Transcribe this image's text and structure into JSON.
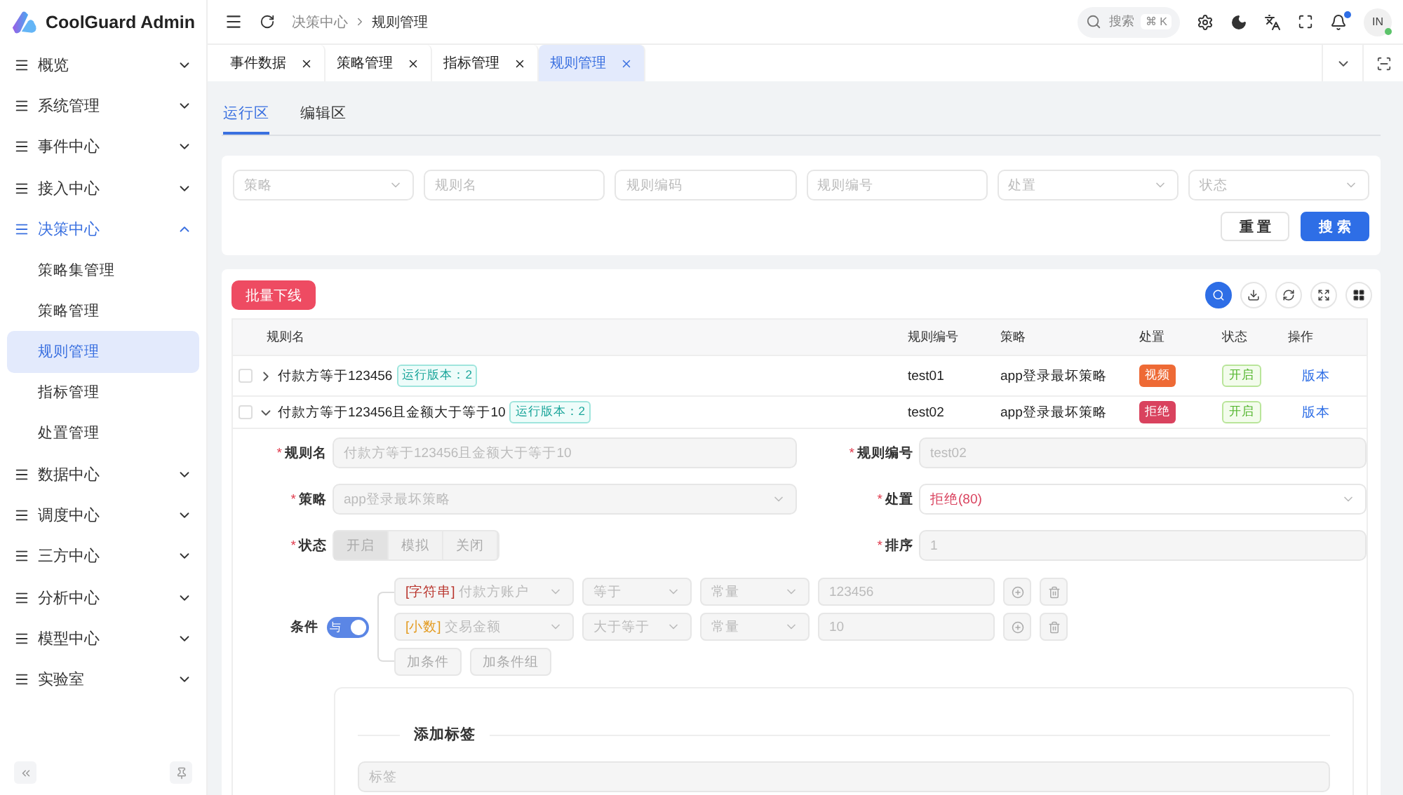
{
  "app": {
    "title": "CoolGuard Admin"
  },
  "sidebar": {
    "items": [
      {
        "label": "概览",
        "expanded": false
      },
      {
        "label": "系统管理",
        "expanded": false
      },
      {
        "label": "事件中心",
        "expanded": false
      },
      {
        "label": "接入中心",
        "expanded": false
      },
      {
        "label": "决策中心",
        "expanded": true,
        "children": [
          {
            "label": "策略集管理",
            "selected": false
          },
          {
            "label": "策略管理",
            "selected": false
          },
          {
            "label": "规则管理",
            "selected": true
          },
          {
            "label": "指标管理",
            "selected": false
          },
          {
            "label": "处置管理",
            "selected": false
          }
        ]
      },
      {
        "label": "数据中心",
        "expanded": false
      },
      {
        "label": "调度中心",
        "expanded": false
      },
      {
        "label": "三方中心",
        "expanded": false
      },
      {
        "label": "分析中心",
        "expanded": false
      },
      {
        "label": "模型中心",
        "expanded": false
      },
      {
        "label": "实验室",
        "expanded": false
      }
    ]
  },
  "header": {
    "breadcrumb": [
      "决策中心",
      "规则管理"
    ],
    "search": {
      "placeholder": "搜索",
      "shortcut": "⌘ K"
    },
    "has_notification": true,
    "avatar": "IN",
    "online": true
  },
  "tabs": [
    {
      "label": "事件数据",
      "selected": false
    },
    {
      "label": "策略管理",
      "selected": false
    },
    {
      "label": "指标管理",
      "selected": false
    },
    {
      "label": "规则管理",
      "selected": true
    }
  ],
  "subtabs": [
    {
      "label": "运行区",
      "selected": true
    },
    {
      "label": "编辑区",
      "selected": false
    }
  ],
  "filters": [
    {
      "kind": "select",
      "placeholder": "策略"
    },
    {
      "kind": "input",
      "placeholder": "规则名"
    },
    {
      "kind": "input",
      "placeholder": "规则编码"
    },
    {
      "kind": "input",
      "placeholder": "规则编号"
    },
    {
      "kind": "select",
      "placeholder": "处置"
    },
    {
      "kind": "select",
      "placeholder": "状态"
    }
  ],
  "filter_buttons": {
    "reset": "重 置",
    "search": "搜 索"
  },
  "batch_button": "批量下线",
  "table": {
    "columns": [
      "规则名",
      "规则编号",
      "策略",
      "处置",
      "状态",
      "操作"
    ],
    "rows": [
      {
        "checked": false,
        "expanded": false,
        "name": "付款方等于123456",
        "version": "运行版本：2",
        "code": "test01",
        "strategy": "app登录最坏策略",
        "action": {
          "label": "视频",
          "color": "#ee6a35"
        },
        "status": "开启",
        "op": "版本"
      },
      {
        "checked": false,
        "expanded": true,
        "name": "付款方等于123456且金额大于等于10",
        "version": "运行版本：2",
        "code": "test02",
        "strategy": "app登录最坏策略",
        "action": {
          "label": "拒绝",
          "color": "#d9425e"
        },
        "status": "开启",
        "op": "版本"
      }
    ]
  },
  "detail": {
    "fields": [
      {
        "kind": "input",
        "required_mark": "*",
        "label": "规则名",
        "disabled": true,
        "value": "付款方等于123456且金额大于等于10"
      },
      {
        "kind": "input",
        "required_mark": "*",
        "label": "规则编号",
        "disabled": true,
        "value": "test02"
      },
      {
        "kind": "select",
        "required_mark": "*",
        "label": "策略",
        "disabled": true,
        "value": "app登录最坏策略",
        "danger": false
      },
      {
        "kind": "select",
        "required_mark": "*",
        "label": "处置",
        "disabled": false,
        "value": "拒绝(80)",
        "danger": true
      },
      {
        "kind": "segmented",
        "required_mark": "*",
        "label": "状态",
        "disabled": true,
        "options": [
          {
            "label": "开启",
            "selected": true
          },
          {
            "label": "模拟",
            "selected": false
          },
          {
            "label": "关闭",
            "selected": false
          }
        ]
      },
      {
        "kind": "input",
        "required_mark": "*",
        "label": "排序",
        "disabled": true,
        "value": "1"
      }
    ],
    "conditions": {
      "label": "条件",
      "logic": "与",
      "logic_on": true,
      "rows": [
        {
          "type": {
            "label": "[字符串]",
            "color": "#b8322a"
          },
          "field": "付款方账户",
          "op": "等于",
          "value_kind": "常量",
          "value": "123456"
        },
        {
          "type": {
            "label": "[小数]",
            "color": "#e39a1e"
          },
          "field": "交易金额",
          "op": "大于等于",
          "value_kind": "常量",
          "value": "10"
        }
      ],
      "buttons": [
        "加条件",
        "加条件组"
      ]
    },
    "tag_card": {
      "title": "添加标签",
      "placeholder": "标签"
    }
  }
}
